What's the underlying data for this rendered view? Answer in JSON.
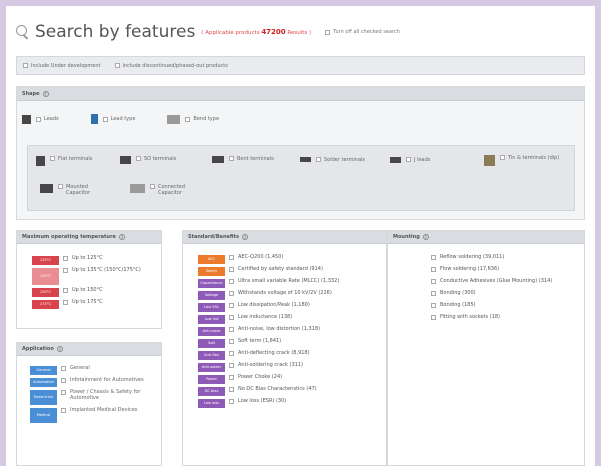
{
  "header": {
    "title": "Search by features",
    "count_prefix": "( Applicable products",
    "count_value": "47200",
    "count_suffix": "Results )",
    "reset_label": "Turn off all checked search"
  },
  "options": [
    "Include Under development",
    "Include discontinued/phased-out products"
  ],
  "shape": {
    "heading": "Shape",
    "primary": [
      "Leads",
      "Lead type",
      "Bend type"
    ],
    "packages": [
      "Flat terminals",
      "SO terminals",
      "Bent terminals",
      "Solder terminals",
      "J leads",
      "Tin & terminals (dip)",
      "Mounted Capacitor",
      "Connected Capacitor"
    ]
  },
  "temp": {
    "heading": "Maximum operating temperature",
    "items": [
      {
        "badge": "125°C",
        "label": "Up to 125°C",
        "tone": "rd"
      },
      {
        "badge": "135°C",
        "label": "Up to 135°C (150°C/175°C)",
        "tone": "rd2"
      },
      {
        "badge": "150°C",
        "label": "Up to 150°C",
        "tone": "rd"
      },
      {
        "badge": "175°C",
        "label": "Up to 175°C",
        "tone": "rd"
      }
    ]
  },
  "application": {
    "heading": "Application",
    "items": [
      {
        "badge": "General",
        "label": "General"
      },
      {
        "badge": "Automotive",
        "label": "Infotainment for Automotives"
      },
      {
        "badge": "Powertrain",
        "label": "Power / Chassis & Safety for Automotive"
      },
      {
        "badge": "Medical",
        "label": "Implanted Medical Devices"
      }
    ]
  },
  "standard": {
    "heading": "Standard/Benefits",
    "items": [
      {
        "badge": "AEC",
        "label": "AEC-Q200 (1,450)",
        "tone": "or"
      },
      {
        "badge": "Safety",
        "label": "Certified by safety standard (914)",
        "tone": "or"
      },
      {
        "badge": "Capacitance",
        "label": "Ultra small variable Rate (MLCC) (1,332)",
        "tone": "pu"
      },
      {
        "badge": "Voltage",
        "label": "Withstands voltage of 10 kV/2V (226)",
        "tone": "pu"
      },
      {
        "badge": "Low ESL",
        "label": "Low dissipation/Peak (1,180)",
        "tone": "pu"
      },
      {
        "badge": "Low Ind",
        "label": "Low inductance (138)",
        "tone": "pu"
      },
      {
        "badge": "Anti-noise",
        "label": "Anti-noise, low distortion (1,318)",
        "tone": "pu"
      },
      {
        "badge": "Soft",
        "label": "Soft term (1,841)",
        "tone": "pu"
      },
      {
        "badge": "Anti-flex",
        "label": "Anti-deflecting crack (8,918)",
        "tone": "pu"
      },
      {
        "badge": "Anti-solder",
        "label": "Anti-soldering crack (311)",
        "tone": "pu"
      },
      {
        "badge": "Power",
        "label": "Power Choke (24)",
        "tone": "pu"
      },
      {
        "badge": "DC bias",
        "label": "No DC Bias Characteristics (47)",
        "tone": "pu"
      },
      {
        "badge": "Low loss",
        "label": "Low loss (ESR) (30)",
        "tone": "pu"
      }
    ]
  },
  "mounting": {
    "heading": "Mounting",
    "items": [
      {
        "badge": "Reflow",
        "label": "Reflow soldering (39,011)",
        "tone": "red"
      },
      {
        "badge": "Flow",
        "label": "Flow soldering (17,636)",
        "tone": "red"
      },
      {
        "badge": "Conductive",
        "label": "Conductive Adhesives (Glue Mounting) (314)",
        "tone": "red"
      },
      {
        "badge": "Bonding",
        "label": "Bonding (300)",
        "tone": "red"
      },
      {
        "badge": "Bonding",
        "label": "Bonding (185)",
        "tone": "red"
      },
      {
        "badge": "Wire",
        "label": "Fitting with sockets (18)",
        "tone": "red"
      }
    ]
  }
}
